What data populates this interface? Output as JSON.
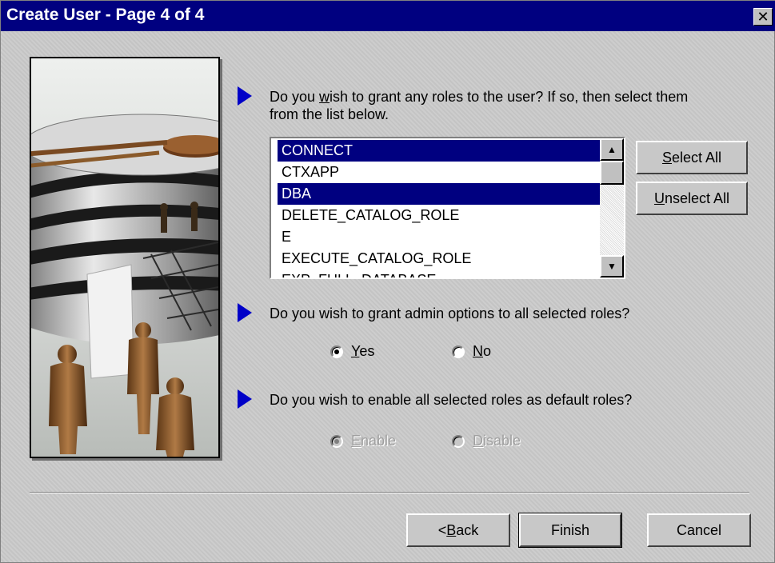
{
  "window": {
    "title": "Create User - Page 4 of 4",
    "close_glyph": "✕"
  },
  "picture": {
    "description_icon": "database-people-illustration"
  },
  "q1": {
    "text_line1_pre": "Do you ",
    "text_line1_ul": "w",
    "text_line1_post": "ish to grant any roles to the user? If so, then select them",
    "text_line2": "from the list below."
  },
  "roles_list": {
    "items": [
      {
        "label": "CONNECT",
        "selected": true
      },
      {
        "label": "CTXAPP",
        "selected": false
      },
      {
        "label": "DBA",
        "selected": true
      },
      {
        "label": "DELETE_CATALOG_ROLE",
        "selected": false
      },
      {
        "label": "E",
        "selected": false
      },
      {
        "label": "EXECUTE_CATALOG_ROLE",
        "selected": false
      },
      {
        "label": "EXP_FULL_DATABASE",
        "selected": false
      }
    ]
  },
  "buttons": {
    "select_all_ul": "S",
    "select_all_rest": "elect All",
    "unselect_all_ul": "U",
    "unselect_all_rest": "nselect All",
    "back_prefix": "< ",
    "back_ul": "B",
    "back_rest": "ack",
    "finish": "Finish",
    "cancel": "Cancel"
  },
  "q2": {
    "text": "Do you wish to grant admin options to all selected roles?"
  },
  "admin_options": {
    "yes_ul": "Y",
    "yes_rest": "es",
    "no_ul": "N",
    "no_rest": "o",
    "selected": "yes"
  },
  "q3": {
    "text": "Do you wish to enable all selected roles as default roles?"
  },
  "default_roles": {
    "enable_ul": "E",
    "enable_rest": "nable",
    "disable_ul": "D",
    "disable_rest": "isable",
    "selected": "enable",
    "disabled": true
  },
  "colors": {
    "title_bg": "#000080",
    "selection": "#000080",
    "bullet": "#0000c8"
  }
}
